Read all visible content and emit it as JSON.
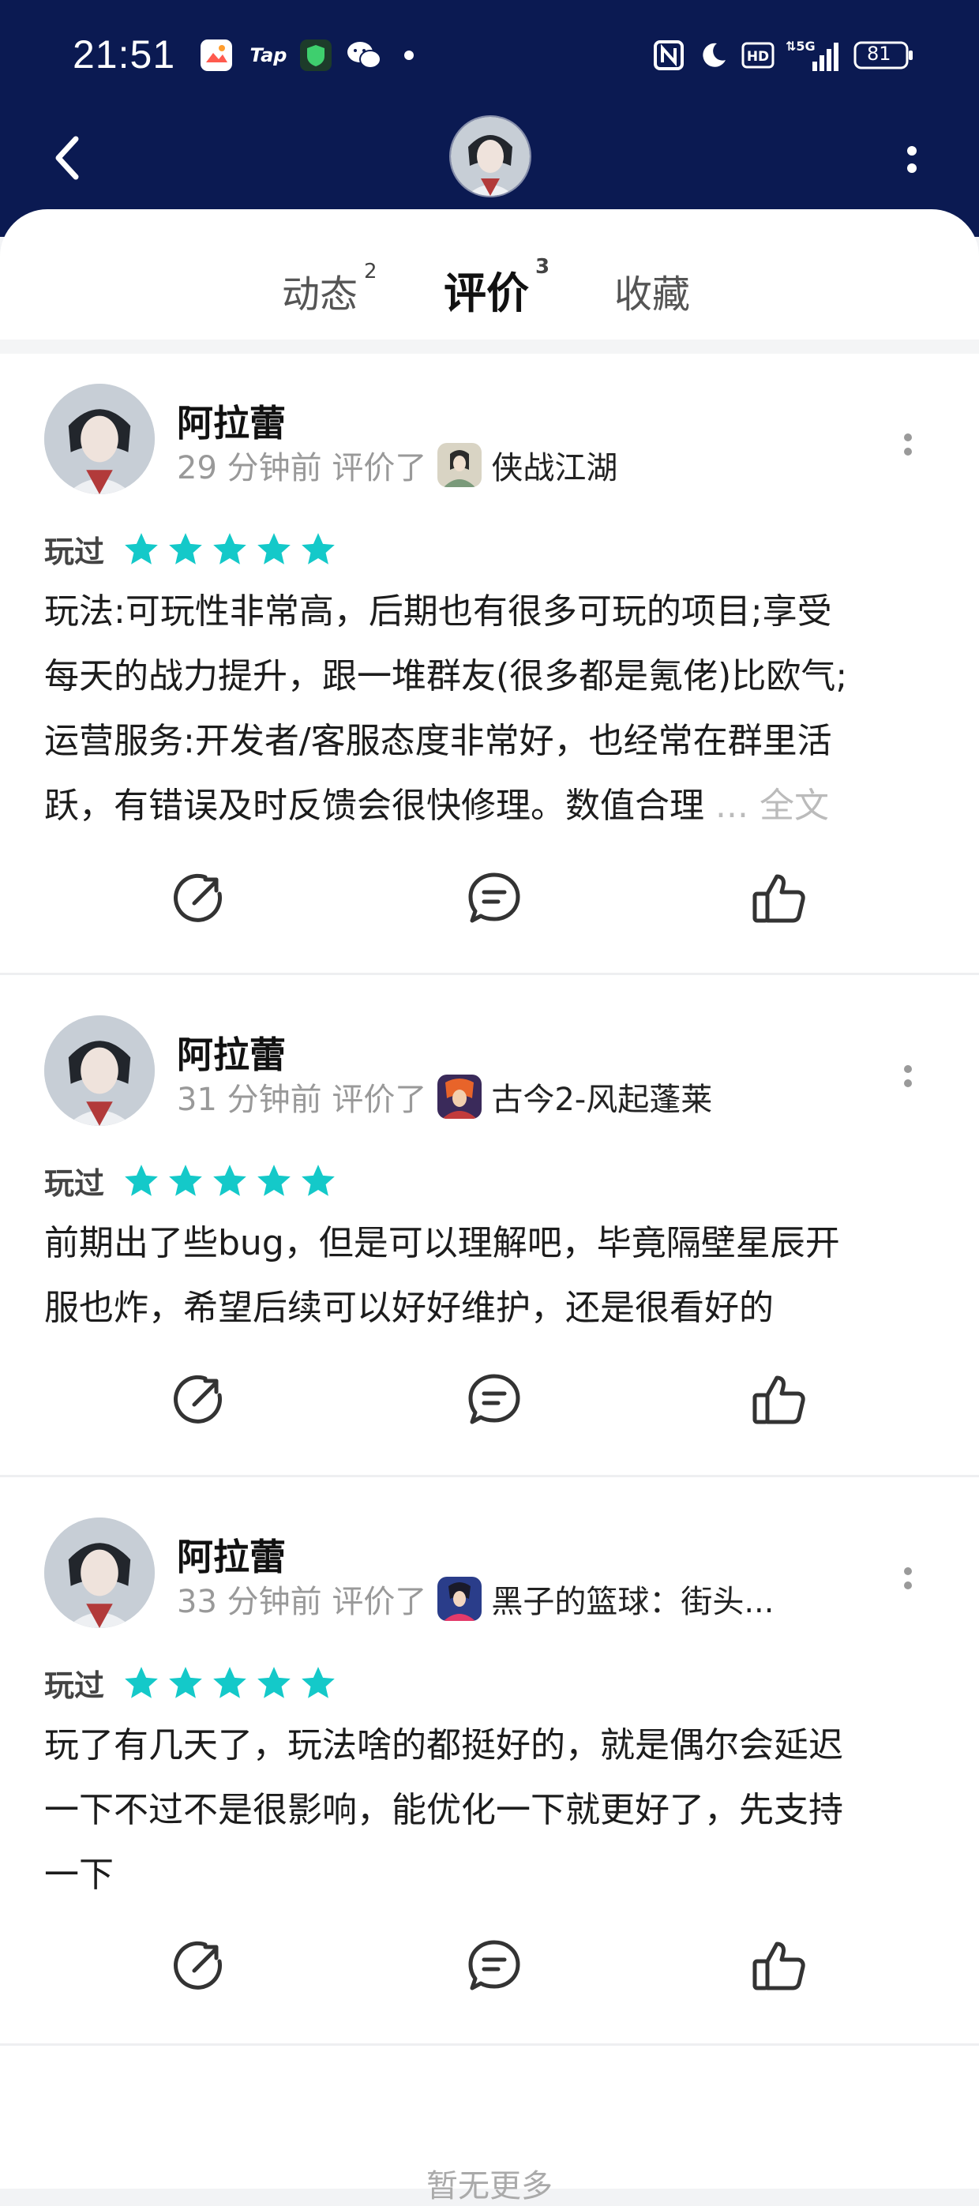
{
  "status_bar": {
    "time": "21:51",
    "battery": "81",
    "network": "5G",
    "hd": "HD",
    "icons": [
      "image-app-icon",
      "taptap-icon",
      "vpn-shield-icon",
      "wechat-icon",
      "dot-icon",
      "nfc-icon",
      "moon-icon",
      "hd-icon",
      "signal-icon",
      "battery-icon"
    ],
    "tap_label": "Tap"
  },
  "tabs": [
    {
      "label": "动态",
      "count": "2"
    },
    {
      "label": "评价",
      "count": "3",
      "active": true
    },
    {
      "label": "收藏",
      "count": ""
    }
  ],
  "colors": {
    "header": "#0b1a52",
    "accent": "#14c9c9",
    "star": "#14c9c9"
  },
  "reviews": [
    {
      "user": "阿拉蕾",
      "time": "29 分钟前 评价了",
      "game": "侠战江湖",
      "played": "玩过",
      "rating": 5,
      "lines": [
        "玩法:可玩性非常高，后期也有很多可玩的项目;享受",
        "每天的战力提升，跟一堆群友(很多都是氪佬)比欧气;",
        "运营服务:开发者/客服态度非常好，也经常在群里活",
        "跃，有错误及时反馈会很快修理。数值合理"
      ],
      "more": "... 全文"
    },
    {
      "user": "阿拉蕾",
      "time": "31 分钟前 评价了",
      "game": "古今2-风起蓬莱",
      "played": "玩过",
      "rating": 5,
      "lines": [
        "前期出了些bug，但是可以理解吧，毕竟隔壁星辰开",
        "服也炸，希望后续可以好好维护，还是很看好的"
      ],
      "more": ""
    },
    {
      "user": "阿拉蕾",
      "time": "33 分钟前 评价了",
      "game": "黑子的篮球：街头...",
      "played": "玩过",
      "rating": 5,
      "lines": [
        "玩了有几天了，玩法啥的都挺好的，就是偶尔会延迟",
        "一下不过不是很影响，能优化一下就更好了，先支持",
        "一下"
      ],
      "more": ""
    }
  ],
  "footer": {
    "no_more": "暂无更多"
  }
}
